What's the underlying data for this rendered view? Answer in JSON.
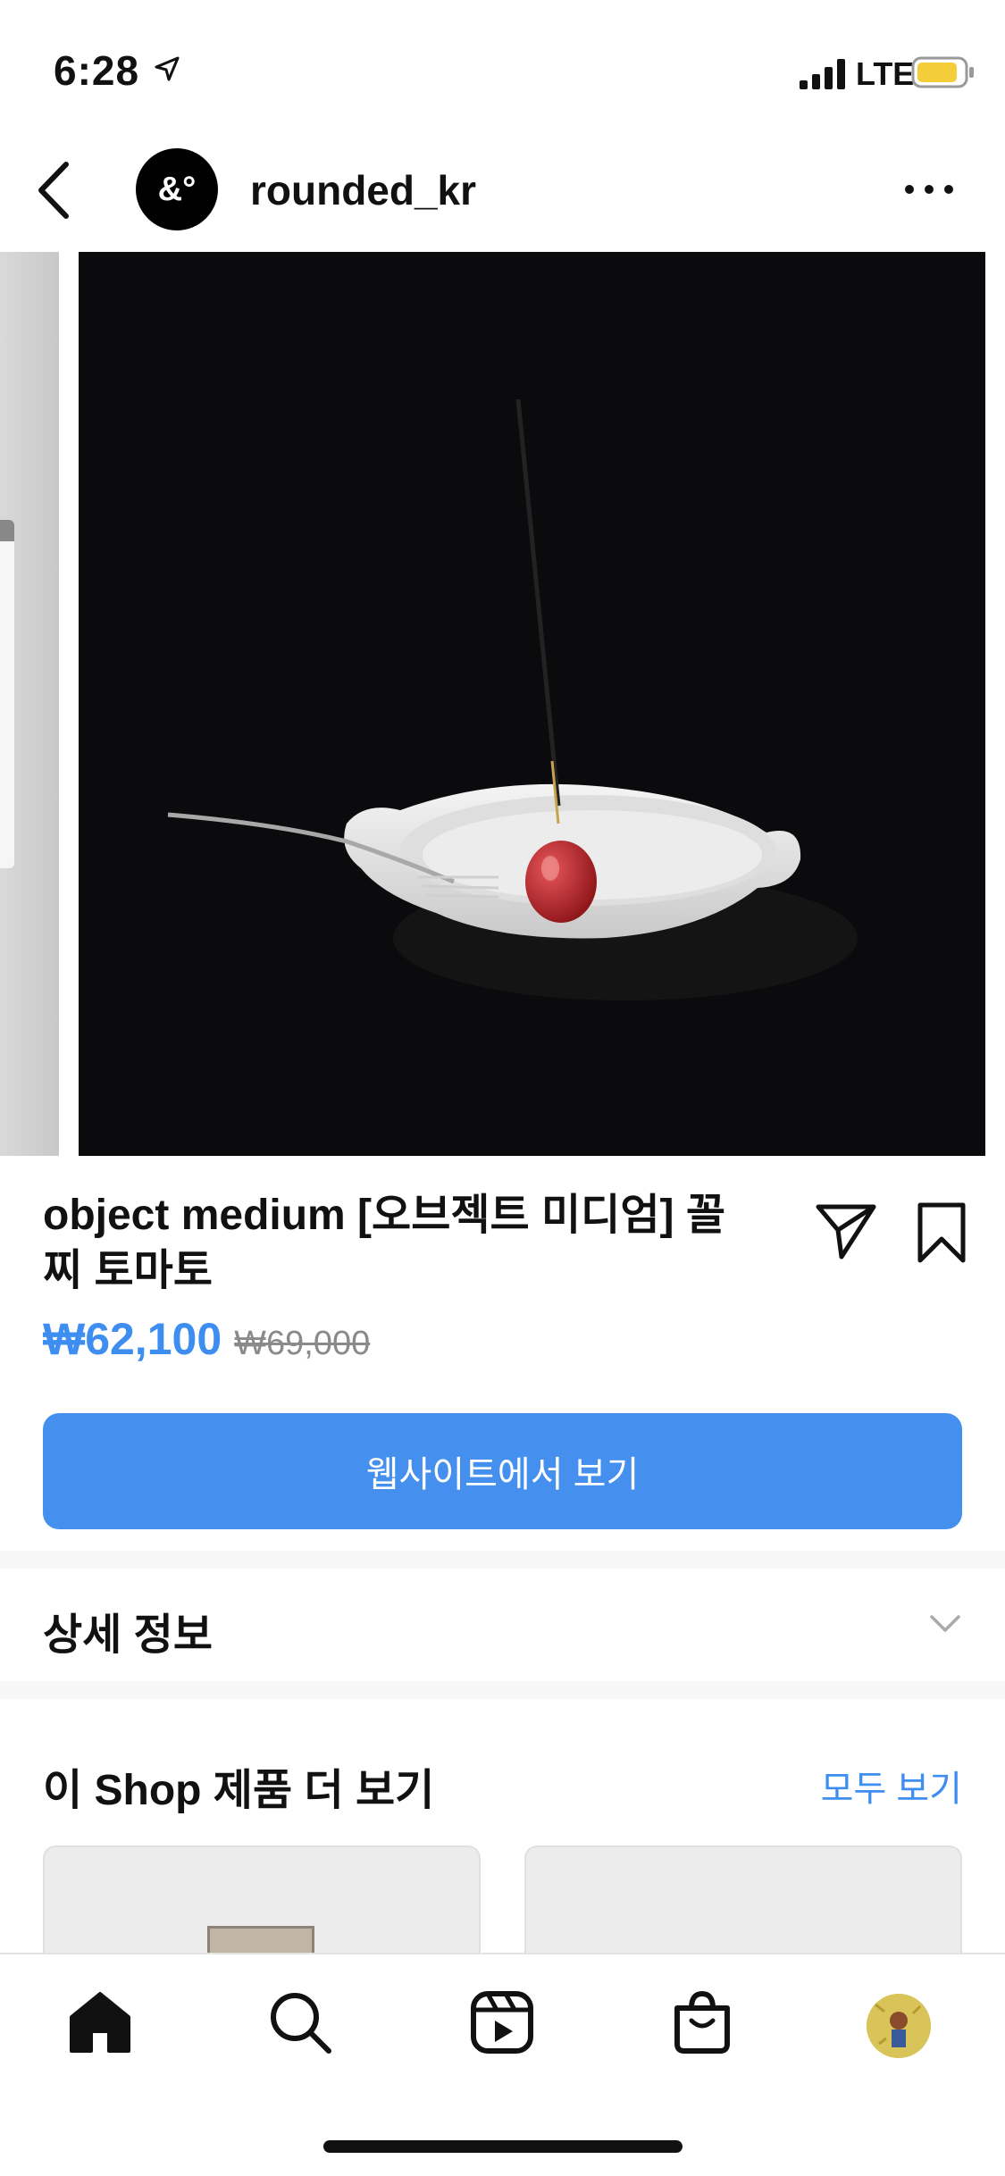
{
  "status_bar": {
    "time": "6:28",
    "network": "LTE",
    "icons": [
      "location-arrow-icon",
      "signal-icon",
      "battery-icon"
    ],
    "battery_color": "#f3cd3a"
  },
  "header": {
    "username": "rounded_kr",
    "avatar_text": "&°",
    "icons": [
      "back-chevron-icon",
      "more-dots-icon"
    ]
  },
  "product": {
    "title": "object medium  [오브젝트 미디엄] 꼴찌 토마토",
    "price": "₩62,100",
    "original_price": "₩69,000",
    "cta_label": "웹사이트에서 보기",
    "icons": [
      "share-paper-plane-icon",
      "bookmark-icon"
    ]
  },
  "details": {
    "label": "상세 정보",
    "icon": "chevron-down-icon"
  },
  "more_from_shop": {
    "label": "이 Shop 제품 더 보기",
    "see_all": "모두 보기"
  },
  "tab_bar": {
    "items": [
      "home-icon",
      "search-icon",
      "reels-icon",
      "shop-bag-icon",
      "profile-avatar"
    ]
  },
  "colors": {
    "accent": "#3d8ef0",
    "button": "#4590ee",
    "photo_bg": "#0b0b0d",
    "tomato": "#c8242a"
  }
}
